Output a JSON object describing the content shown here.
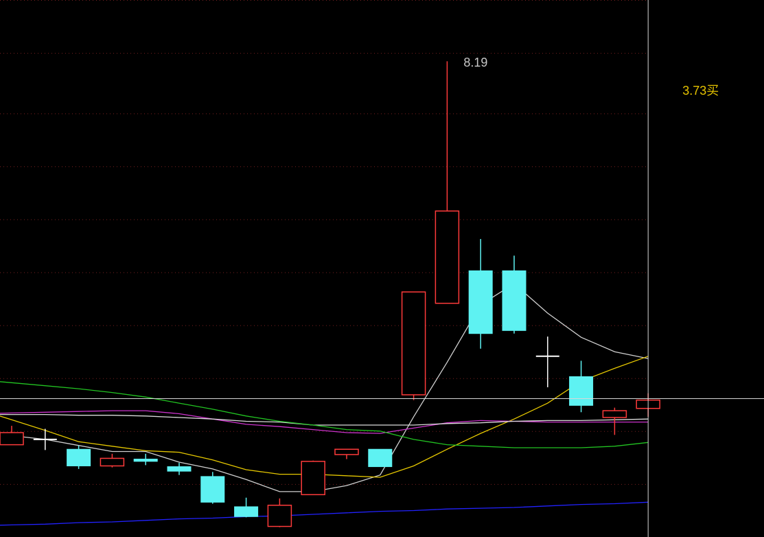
{
  "chart_data": {
    "type": "candlestick",
    "ylim": [
      1.9,
      9.0
    ],
    "grid": true,
    "crosshair_price": 3.73,
    "annotations": {
      "high_label": "8.19",
      "crosshair_label": "3.73买"
    },
    "colors": {
      "up": "#ff3b3b",
      "down": "#5ef2f2",
      "doji": "#ffffff",
      "grid": "#7a2020",
      "crosshair": "#d8d8d8",
      "crosshair_label": "#e6c300"
    },
    "candles": [
      {
        "o": 3.12,
        "c": 3.28,
        "h": 3.37,
        "l": 3.12,
        "color": "up"
      },
      {
        "o": 3.19,
        "c": 3.19,
        "h": 3.33,
        "l": 3.05,
        "color": "doji"
      },
      {
        "o": 3.06,
        "c": 2.84,
        "h": 3.11,
        "l": 2.8,
        "color": "down"
      },
      {
        "o": 2.84,
        "c": 2.94,
        "h": 3.0,
        "l": 2.82,
        "color": "up"
      },
      {
        "o": 2.93,
        "c": 2.9,
        "h": 3.0,
        "l": 2.85,
        "color": "down"
      },
      {
        "o": 2.83,
        "c": 2.77,
        "h": 2.88,
        "l": 2.72,
        "color": "down"
      },
      {
        "o": 2.7,
        "c": 2.36,
        "h": 2.76,
        "l": 2.34,
        "color": "down"
      },
      {
        "o": 2.3,
        "c": 2.17,
        "h": 2.42,
        "l": 2.16,
        "color": "down"
      },
      {
        "o": 2.04,
        "c": 2.32,
        "h": 2.41,
        "l": 2.03,
        "color": "up"
      },
      {
        "o": 2.46,
        "c": 2.9,
        "h": 2.91,
        "l": 2.46,
        "color": "up"
      },
      {
        "o": 2.99,
        "c": 3.06,
        "h": 3.06,
        "l": 2.93,
        "color": "up"
      },
      {
        "o": 3.06,
        "c": 2.83,
        "h": 3.06,
        "l": 2.83,
        "color": "down"
      },
      {
        "o": 3.78,
        "c": 5.14,
        "h": 5.14,
        "l": 3.71,
        "color": "up"
      },
      {
        "o": 4.99,
        "c": 6.21,
        "h": 8.19,
        "l": 4.99,
        "color": "up"
      },
      {
        "o": 5.42,
        "c": 4.59,
        "h": 5.84,
        "l": 4.39,
        "color": "down"
      },
      {
        "o": 5.42,
        "c": 4.63,
        "h": 5.62,
        "l": 4.59,
        "color": "down"
      },
      {
        "o": 4.29,
        "c": 4.29,
        "h": 4.55,
        "l": 3.88,
        "color": "doji"
      },
      {
        "o": 4.02,
        "c": 3.64,
        "h": 4.23,
        "l": 3.55,
        "color": "down"
      },
      {
        "o": 3.57,
        "c": 3.48,
        "h": 3.61,
        "l": 3.25,
        "color": "up"
      },
      {
        "o": 3.71,
        "c": 3.6,
        "h": 3.8,
        "l": 3.49,
        "color": "up"
      }
    ],
    "series": [
      {
        "color": "#d0d0d0",
        "values": [
          3.24,
          3.19,
          3.11,
          3.03,
          3.03,
          2.89,
          2.8,
          2.66,
          2.5,
          2.5,
          2.58,
          2.72,
          3.49,
          4.21,
          4.97,
          5.25,
          4.86,
          4.54,
          4.35,
          4.26
        ]
      },
      {
        "color": "#e6c800",
        "values": [
          3.45,
          3.31,
          3.16,
          3.1,
          3.04,
          3.02,
          2.92,
          2.79,
          2.73,
          2.73,
          2.71,
          2.69,
          2.84,
          3.06,
          3.27,
          3.46,
          3.67,
          3.96,
          4.13,
          4.29
        ]
      },
      {
        "color": "#cc33cc",
        "values": [
          3.54,
          3.55,
          3.56,
          3.57,
          3.57,
          3.53,
          3.46,
          3.39,
          3.36,
          3.32,
          3.28,
          3.27,
          3.34,
          3.41,
          3.44,
          3.43,
          3.42,
          3.42,
          3.42,
          3.42
        ]
      },
      {
        "color": "#dcdcdc",
        "values": [
          3.52,
          3.52,
          3.51,
          3.51,
          3.5,
          3.48,
          3.46,
          3.43,
          3.42,
          3.38,
          3.38,
          3.38,
          3.38,
          3.4,
          3.41,
          3.43,
          3.44,
          3.44,
          3.45,
          3.46
        ]
      },
      {
        "color": "#22c422",
        "values": [
          3.94,
          3.9,
          3.86,
          3.81,
          3.75,
          3.67,
          3.59,
          3.5,
          3.43,
          3.38,
          3.32,
          3.3,
          3.19,
          3.12,
          3.1,
          3.08,
          3.08,
          3.08,
          3.1,
          3.15
        ]
      },
      {
        "color": "#2222ff",
        "values": [
          2.06,
          2.07,
          2.09,
          2.1,
          2.12,
          2.14,
          2.15,
          2.17,
          2.18,
          2.2,
          2.22,
          2.24,
          2.25,
          2.27,
          2.28,
          2.29,
          2.31,
          2.33,
          2.34,
          2.36
        ]
      }
    ]
  }
}
